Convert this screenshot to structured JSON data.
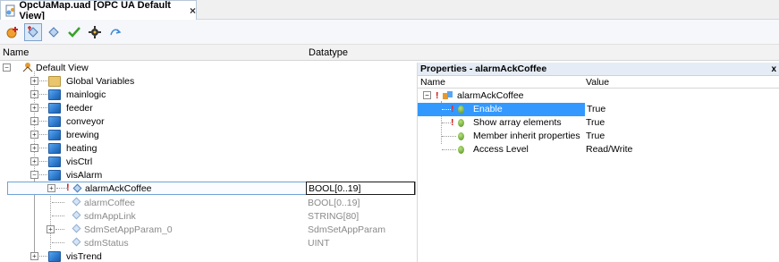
{
  "tab": {
    "title": "OpcUaMap.uad [OPC UA Default View]",
    "close": "×"
  },
  "toolbar": {
    "icons": [
      "add-icon",
      "tag-add-icon",
      "tag-icon",
      "check-icon",
      "gear-icon",
      "refresh-icon"
    ]
  },
  "columns": {
    "name": "Name",
    "datatype": "Datatype"
  },
  "tree": {
    "root": {
      "label": "Default View",
      "expander": "−"
    },
    "nodes": [
      {
        "label": "Global Variables",
        "icon": "folder-icon",
        "expander": "+"
      },
      {
        "label": "mainlogic",
        "icon": "cube-icon",
        "expander": "+"
      },
      {
        "label": "feeder",
        "icon": "cube-icon",
        "expander": "+"
      },
      {
        "label": "conveyor",
        "icon": "cube-icon",
        "expander": "+"
      },
      {
        "label": "brewing",
        "icon": "cube-icon",
        "expander": "+"
      },
      {
        "label": "heating",
        "icon": "cube-icon",
        "expander": "+"
      },
      {
        "label": "visCtrl",
        "icon": "cube-icon",
        "expander": "+"
      },
      {
        "label": "visAlarm",
        "icon": "cube-icon",
        "expander": "−"
      }
    ],
    "visAlarm_children": [
      {
        "label": "alarmAckCoffee",
        "datatype": "BOOL[0..19]",
        "expander": "+",
        "marker": "!"
      },
      {
        "label": "alarmCoffee",
        "datatype": "BOOL[0..19]"
      },
      {
        "label": "sdmAppLink",
        "datatype": "STRING[80]"
      },
      {
        "label": "SdmSetAppParam_0",
        "datatype": "SdmSetAppParam",
        "expander": "+"
      },
      {
        "label": "sdmStatus",
        "datatype": "UINT"
      }
    ],
    "last": {
      "label": "visTrend",
      "icon": "cube-icon",
      "expander": "+"
    }
  },
  "properties": {
    "title": "Properties - alarmAckCoffee",
    "close": "x",
    "col_name": "Name",
    "col_value": "Value",
    "node": {
      "label": "alarmAckCoffee",
      "expander": "−",
      "marker": "!"
    },
    "rows": [
      {
        "name": "Enable",
        "value": "True",
        "marker": "!"
      },
      {
        "name": "Show array elements",
        "value": "True",
        "marker": "!"
      },
      {
        "name": "Member inherit properties",
        "value": "True"
      },
      {
        "name": "Access Level",
        "value": "Read/Write"
      }
    ]
  },
  "colors": {
    "selection": "#3399ff",
    "cube": "#2c78cc",
    "folder": "#e9c66b",
    "marker": "#d01010"
  }
}
